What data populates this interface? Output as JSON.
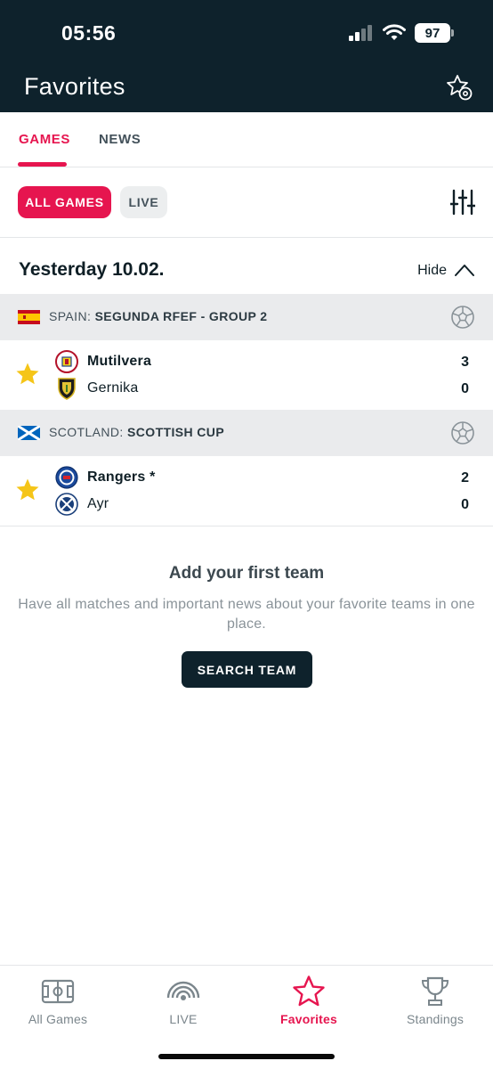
{
  "status_bar": {
    "time": "05:56",
    "battery": "97"
  },
  "header": {
    "title": "Favorites"
  },
  "tabs": [
    {
      "label": "GAMES",
      "active": true
    },
    {
      "label": "NEWS",
      "active": false
    }
  ],
  "filters": {
    "all_games": "ALL GAMES",
    "live": "LIVE"
  },
  "day": {
    "date": "Yesterday 10.02.",
    "hide_label": "Hide"
  },
  "leagues": [
    {
      "country": "SPAIN:",
      "name": "SEGUNDA RFEF - GROUP 2",
      "match": {
        "home": {
          "name": "Mutilvera",
          "score": "3"
        },
        "away": {
          "name": "Gernika",
          "score": "0"
        }
      }
    },
    {
      "country": "SCOTLAND:",
      "name": "SCOTTISH CUP",
      "match": {
        "home": {
          "name": "Rangers *",
          "score": "2"
        },
        "away": {
          "name": "Ayr",
          "score": "0"
        }
      }
    }
  ],
  "empty_state": {
    "title": "Add your first team",
    "description": "Have all matches and important news about your favorite teams in one place.",
    "button": "SEARCH TEAM"
  },
  "bottom_nav": [
    {
      "label": "All Games",
      "icon": "field-icon"
    },
    {
      "label": "LIVE",
      "icon": "live-icon"
    },
    {
      "label": "Favorites",
      "icon": "star-icon",
      "active": true
    },
    {
      "label": "Standings",
      "icon": "trophy-icon"
    }
  ],
  "colors": {
    "accent": "#e6154f",
    "header_bg": "#0e222c",
    "star": "#f5c518"
  }
}
